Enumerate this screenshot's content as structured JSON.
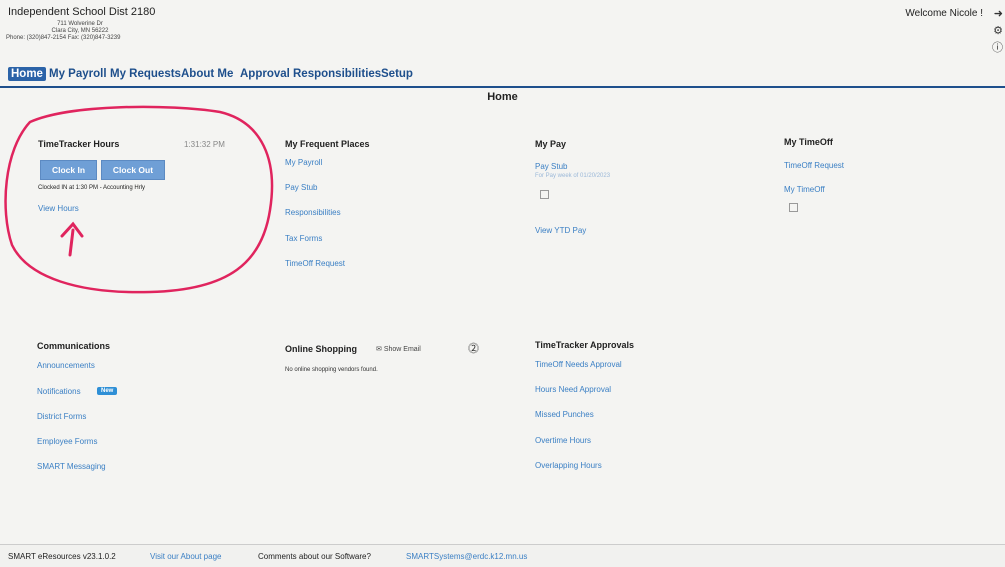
{
  "header": {
    "org_name": "Independent School Dist 2180",
    "address": "711 Wolverine Dr",
    "city": "Clara City, MN 56222",
    "phone": "Phone: (320)847-2154 Fax: (320)847-3239",
    "welcome": "Welcome Nicole !"
  },
  "nav": {
    "items": [
      "Home",
      "My Payroll",
      "My Requests",
      "About Me",
      "Approval",
      "Responsibilities",
      "Setup"
    ],
    "active": "Home"
  },
  "page_title": "Home",
  "timetracker": {
    "title": "TimeTracker Hours",
    "time": "1:31:32 PM",
    "clock_in": "Clock In",
    "clock_out": "Clock Out",
    "status": "Clocked IN at 1:30 PM - Accounting Hrly",
    "view_hours": "View Hours"
  },
  "frequent": {
    "title": "My Frequent Places",
    "links": [
      "My Payroll",
      "Pay Stub",
      "Responsibilities",
      "Tax Forms",
      "TimeOff Request"
    ]
  },
  "mypay": {
    "title": "My Pay",
    "pay_stub": "Pay Stub",
    "sub": "For Pay week of 01/20/2023",
    "view_ytd": "View YTD Pay"
  },
  "timeoff": {
    "title": "My TimeOff",
    "request": "TimeOff Request",
    "my_timeoff": "My TimeOff"
  },
  "communications": {
    "title": "Communications",
    "links": [
      "Announcements",
      "Notifications",
      "District Forms",
      "Employee Forms",
      "SMART Messaging"
    ],
    "badge": "New"
  },
  "shopping": {
    "title": "Online Shopping",
    "show_email": "Show Email",
    "empty": "No online shopping vendors found."
  },
  "approvals": {
    "title": "TimeTracker Approvals",
    "links": [
      "TimeOff Needs Approval",
      "Hours Need Approval",
      "Missed Punches",
      "Overtime Hours",
      "Overlapping Hours"
    ]
  },
  "footer": {
    "version": "SMART eResources v23.1.0.2",
    "about_link": "Visit our About page",
    "comments": "Comments about our Software?",
    "email": "SMARTSystems@erdc.k12.mn.us"
  },
  "colors": {
    "link": "#3a7fc4",
    "nav": "#1e4f8c",
    "annotation": "#e0245e"
  }
}
